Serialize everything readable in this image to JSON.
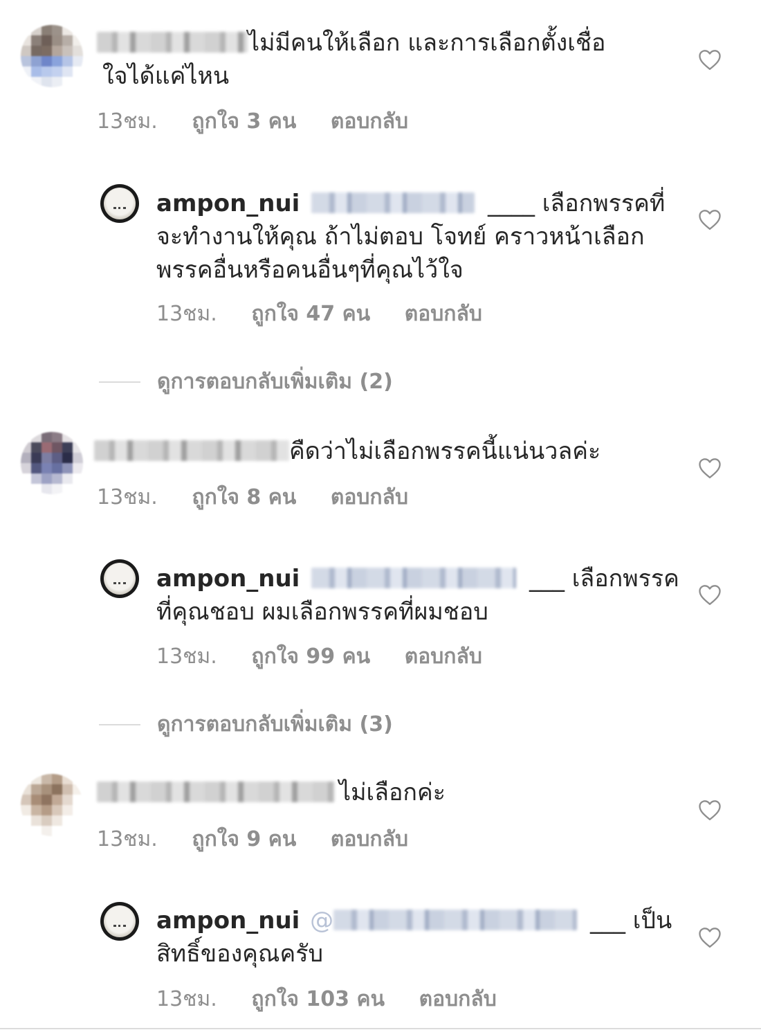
{
  "comments": [
    {
      "text": "ไม่มีคนให้เลือก และการเลือกตั้งเชื่อ",
      "text_line2": "ใจได้แค่ไหน",
      "time": "13ชม.",
      "likes": "ถูกใจ 3 คน",
      "reply": "ตอบกลับ",
      "avatar_colors": [
        "#ffffff",
        "#d6d0cb",
        "#8a7f76",
        "#9c928a",
        "#ece8e4",
        "#ffffff",
        "#e8e3de",
        "#8b8079",
        "#6e5f58",
        "#9a8e85",
        "#b7aea7",
        "#f1eeea",
        "#cfc8c2",
        "#776a62",
        "#7c6c62",
        "#b4a69c",
        "#c9c1bb",
        "#e3dfdb",
        "#b9c4dd",
        "#8ea2d2",
        "#6f86c9",
        "#8aa3dc",
        "#b5c4e6",
        "#e6eaf3",
        "#eef1f7",
        "#a9bde8",
        "#b8c9ec",
        "#c3d1ef",
        "#dfe5f3",
        "#ffffff",
        "#ffffff",
        "#f0f2f7",
        "#dfe4ee",
        "#ebeef4",
        "#ffffff",
        "#ffffff"
      ]
    },
    {
      "text": "คืดว่าไม่เลือกพรรคนี้แน่นวลค่ะ",
      "time": "13ชม.",
      "likes": "ถูกใจ 8 คน",
      "reply": "ตอบกลับ",
      "avatar_colors": [
        "#ffffff",
        "#dcd9dc",
        "#7a6d78",
        "#8b7c86",
        "#e4e0e3",
        "#ffffff",
        "#cfcbd1",
        "#4b4b5c",
        "#9a6b74",
        "#6f5663",
        "#3d3f57",
        "#e7e5e8",
        "#b3b0bd",
        "#3a3b56",
        "#7d7ea3",
        "#5d5e85",
        "#2b2d49",
        "#cfcdd6",
        "#d6d3da",
        "#53587f",
        "#7a82b3",
        "#6770a1",
        "#8e93b8",
        "#ebe9ee",
        "#ffffff",
        "#c4c6d9",
        "#9da2c4",
        "#b6b9d1",
        "#e9e9ef",
        "#ffffff",
        "#ffffff",
        "#ffffff",
        "#e7e7ee",
        "#f3f3f6",
        "#ffffff",
        "#ffffff"
      ]
    },
    {
      "text": "ไม่เลือกค่ะ",
      "time": "13ชม.",
      "likes": "ถูกใจ 9 คน",
      "reply": "ตอบกลับ",
      "avatar_colors": [
        "#ffffff",
        "#ece6de",
        "#c9b8a8",
        "#b49d88",
        "#e8ddd2",
        "#ffffff",
        "#e9e1d8",
        "#bba896",
        "#a8917c",
        "#8c735e",
        "#d0bfb0",
        "#f5f0ea",
        "#d5c6b9",
        "#a88d77",
        "#8f7460",
        "#c1a996",
        "#e4d9cf",
        "#ffffff",
        "#f1ebe4",
        "#c9b5a3",
        "#b59c87",
        "#d8c8ba",
        "#f3ede7",
        "#ffffff",
        "#ffffff",
        "#eae2da",
        "#d9ccc0",
        "#efe8e1",
        "#ffffff",
        "#ffffff",
        "#ffffff",
        "#ffffff",
        "#f4f0ec",
        "#ffffff",
        "#ffffff",
        "#ffffff"
      ]
    }
  ],
  "replies": [
    {
      "username": "ampon_nui",
      "separator": "____",
      "line1": "เลือกพรรคที่",
      "line2": "จะทำงานให้คุณ ถ้าไม่ตอบ โจทย์ คราวหน้าเลือก",
      "line3": "พรรคอื่นหรือคนอื่นๆที่คุณไว้ใจ",
      "time": "13ชม.",
      "likes": "ถูกใจ 47 คน",
      "reply": "ตอบกลับ"
    },
    {
      "username": "ampon_nui",
      "separator": "___",
      "line1": "เลือกพรรค",
      "line2": "ที่คุณชอบ ผมเลือกพรรคที่ผมชอบ",
      "time": "13ชม.",
      "likes": "ถูกใจ 99 คน",
      "reply": "ตอบกลับ"
    },
    {
      "username": "ampon_nui",
      "mention_prefix": "@",
      "separator": "___",
      "line1": "เป็น",
      "line2": "สิทธิ์ของคุณครับ",
      "time": "13ชม.",
      "likes": "ถูกใจ 103 คน",
      "reply": "ตอบกลับ"
    }
  ],
  "view_more": [
    "ดูการตอบกลับเพิ่มเติม (2)",
    "ดูการตอบกลับเพิ่มเติม (3)"
  ],
  "colors": {
    "text": "#262626",
    "meta": "#8e8e8e",
    "divider": "#dbdbdb",
    "heart_stroke": "#8e8e8e"
  },
  "icons": {
    "like": "heart-outline-icon"
  }
}
